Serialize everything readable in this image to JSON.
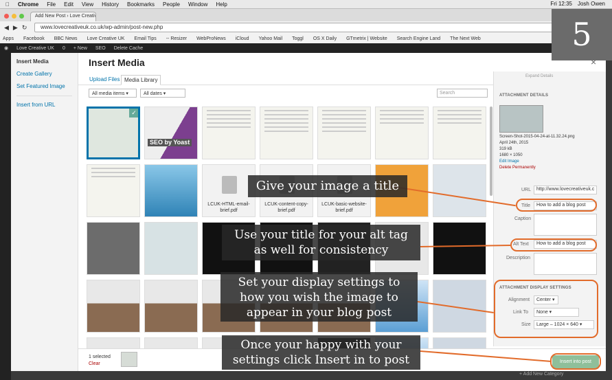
{
  "menubar": {
    "apple": "",
    "app": "Chrome",
    "items": [
      "File",
      "Edit",
      "View",
      "History",
      "Bookmarks",
      "People",
      "Window",
      "Help"
    ],
    "time": "Fri 12:35",
    "user": "Josh Owen"
  },
  "browser": {
    "tab_title": "Add New Post › Love Creativ",
    "url": "www.lovecreativeuk.co.uk/wp-admin/post-new.php",
    "bookmarks": [
      "Apps",
      "Facebook",
      "BBC News",
      "Love Creative UK",
      "Email Tips",
      "-- Resizer",
      "WebProNews",
      "iCloud",
      "Yahoo Mail",
      "Toggl",
      "OS X Daily",
      "GTmetrix | Website",
      "Search Engine Land",
      "The Next Web"
    ]
  },
  "wp": {
    "site": "Love Creative UK",
    "comments": "0",
    "new": "+ New",
    "seo": "SEO",
    "delete_cache": "Delete Cache"
  },
  "modal": {
    "title": "Insert Media",
    "close": "×",
    "sidebar": {
      "insert_media": "Insert Media",
      "create_gallery": "Create Gallery",
      "set_featured": "Set Featured Image",
      "insert_url": "Insert from URL"
    },
    "tabs": {
      "upload": "Upload Files",
      "library": "Media Library"
    },
    "filters": {
      "type": "All media items",
      "date": "All dates",
      "search_placeholder": "Search"
    },
    "files": [
      "LCUK-HTML-email-brief.pdf",
      "LCUK-content-copy-brief.pdf",
      "LCUK-basic-website-brief.pdf"
    ],
    "seo_yoast": "SEO by Yoast",
    "details": {
      "heading": "ATTACHMENT DETAILS",
      "expand": "Expand Details",
      "filename": "Screen-Shot-2015-04-24-at-11.32.24.png",
      "date": "April 24th, 2015",
      "size": "319 kB",
      "dims": "1680 × 1050",
      "edit": "Edit Image",
      "delete": "Delete Permanently",
      "url_label": "URL",
      "url_value": "http://www.lovecreativeuk.c",
      "title_label": "Title",
      "title_value": "How to add a blog post",
      "caption_label": "Caption",
      "alt_label": "Alt Text",
      "alt_value": "How to add a blog post",
      "desc_label": "Description"
    },
    "display": {
      "heading": "ATTACHMENT DISPLAY SETTINGS",
      "align_label": "Alignment",
      "align_value": "Center",
      "link_label": "Link To",
      "link_value": "None",
      "size_label": "Size",
      "size_value": "Large – 1024 × 640"
    },
    "footer": {
      "selected": "1 selected",
      "clear": "Clear",
      "insert": "Insert into post"
    }
  },
  "callouts": {
    "c1": "Give your image a title",
    "c2a": "Use your title for your alt tag",
    "c2b": "as well for consistency",
    "c3a": "Set your display settings to",
    "c3b": "how you wish the image to",
    "c3c": "appear in your blog post",
    "c4a": "Once your happy with your",
    "c4b": "settings click Insert in to post"
  },
  "step": "5",
  "bottom_link": "+ Add New Category"
}
